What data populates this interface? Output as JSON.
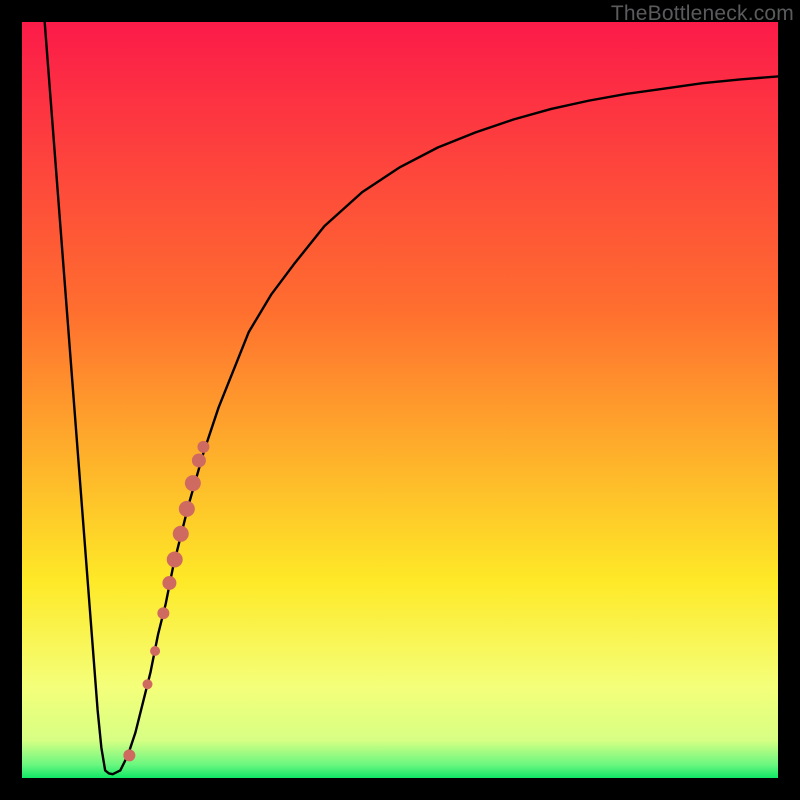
{
  "watermark": "TheBottleneck.com",
  "colors": {
    "frame": "#000000",
    "curve": "#000000",
    "dots": "#cf6a60",
    "gradient_top": "#fc1b49",
    "gradient_mid1": "#ff6e2f",
    "gradient_mid2": "#fee927",
    "gradient_band": "#f4ff7a",
    "gradient_bottom": "#10e766"
  },
  "chart_data": {
    "type": "line",
    "title": "",
    "xlabel": "",
    "ylabel": "",
    "xlim": [
      0,
      100
    ],
    "ylim": [
      0,
      100
    ],
    "curve": {
      "x": [
        3,
        4,
        5,
        6,
        7,
        8,
        9,
        10,
        10.5,
        11,
        11.5,
        12,
        13,
        14,
        15,
        16,
        17,
        18,
        19,
        20,
        22,
        24,
        26,
        28,
        30,
        33,
        36,
        40,
        45,
        50,
        55,
        60,
        65,
        70,
        75,
        80,
        85,
        90,
        95,
        100
      ],
      "y": [
        100,
        87,
        74,
        61,
        48,
        35,
        22,
        9,
        4,
        1,
        0.6,
        0.5,
        1,
        3,
        6,
        10,
        14,
        19,
        23,
        28,
        36,
        43,
        49,
        54,
        59,
        64,
        68,
        73,
        77.5,
        80.8,
        83.4,
        85.4,
        87.1,
        88.5,
        89.6,
        90.5,
        91.2,
        91.9,
        92.4,
        92.8
      ]
    },
    "dots_series": [
      {
        "x": 14.2,
        "y": 3.0,
        "r": 6
      },
      {
        "x": 16.6,
        "y": 12.4,
        "r": 5
      },
      {
        "x": 17.6,
        "y": 16.8,
        "r": 5
      },
      {
        "x": 18.7,
        "y": 21.8,
        "r": 6
      },
      {
        "x": 19.5,
        "y": 25.8,
        "r": 7
      },
      {
        "x": 20.2,
        "y": 28.9,
        "r": 8
      },
      {
        "x": 21.0,
        "y": 32.3,
        "r": 8
      },
      {
        "x": 21.8,
        "y": 35.6,
        "r": 8
      },
      {
        "x": 22.6,
        "y": 39.0,
        "r": 8
      },
      {
        "x": 23.4,
        "y": 42.0,
        "r": 7
      },
      {
        "x": 24.0,
        "y": 43.8,
        "r": 6
      }
    ]
  }
}
